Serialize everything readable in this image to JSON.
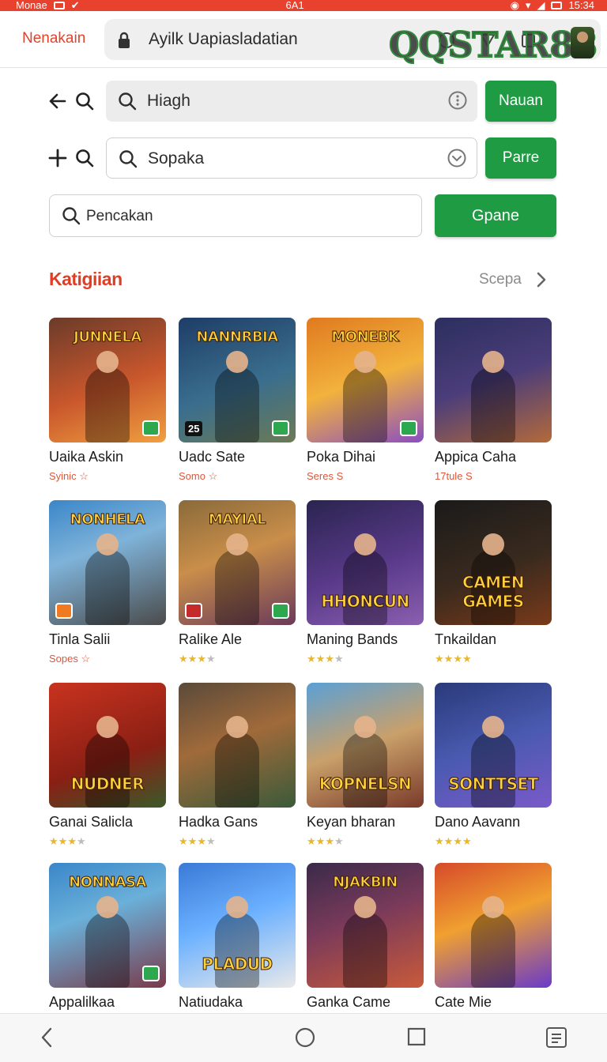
{
  "status_bar": {
    "carrier": "Monae",
    "clock_center": "6A1",
    "time": "15:34"
  },
  "browser": {
    "tab_label": "Nenakain",
    "url": "Ayilk Uapiasladatian",
    "brand_logo": "QQSTAR88"
  },
  "search_rows": [
    {
      "value": "Hiagh",
      "button": "Nauan",
      "style": "grey",
      "trailing_icon": "info-circle-icon",
      "lead_icons": [
        "back-arrow-icon",
        "search-icon"
      ]
    },
    {
      "value": "Sopaka",
      "button": "Parre",
      "style": "outline",
      "trailing_icon": "chevron-down-circle-icon",
      "lead_icons": [
        "plus-icon",
        "search-icon"
      ]
    },
    {
      "value": "Pencakan",
      "button": "Gpane",
      "style": "outline"
    }
  ],
  "section": {
    "title": "Katigiian",
    "link": "Scepa"
  },
  "games": [
    {
      "name": "Uaika Askin",
      "sub": "Syinic ☆",
      "thumb_text": "JUNNELA",
      "bg": "linear-gradient(160deg,#6b3b2a,#c9572c 55%,#f0a040)",
      "badge": "green"
    },
    {
      "name": "Uadc Sate",
      "sub": "Somo ☆",
      "thumb_text": "NANNRBIA",
      "bg": "linear-gradient(160deg,#1e3d66,#3a6e8e 55%,#6b7a55)",
      "badge": "green",
      "corner_num": "25"
    },
    {
      "name": "Poka Dihai",
      "sub": "Seres S",
      "thumb_text": "MONEBK",
      "bg": "linear-gradient(160deg,#e07a1f,#f2b23d 50%,#8a4ec2)",
      "badge": "green"
    },
    {
      "name": "Appica Caha",
      "sub": "17tule S",
      "thumb_text": "",
      "bg": "linear-gradient(160deg,#2c2f5e,#4b3d7a 50%,#b36a3a)",
      "badge": ""
    },
    {
      "name": "Tinla Salii",
      "sub": "Sopes ☆",
      "thumb_text": "NONHELA",
      "bg": "linear-gradient(160deg,#3a86c9,#7fb3d9 40%,#4b4b4b)",
      "badge": "orange-left"
    },
    {
      "name": "Ralike Ale",
      "rating": 3,
      "thumb_text": "MAYIAL",
      "bg": "linear-gradient(160deg,#8a6a3a,#c98e4a 45%,#6a3a5a)",
      "badge": "green-red"
    },
    {
      "name": "Maning Bands",
      "rating": 3,
      "thumb_text": "HHONCUN",
      "thumb_low": true,
      "bg": "linear-gradient(160deg,#2a2450,#5a3a8a 55%,#8b5fb0)",
      "badge": ""
    },
    {
      "name": "Tnkaildan",
      "rating": 4,
      "thumb_text": "CAMEN GAMES",
      "thumb_low": true,
      "bg": "linear-gradient(160deg,#1a1a1a,#3a2a1e 55%,#7a3a1a)",
      "badge": ""
    },
    {
      "name": "Ganai Salicla",
      "rating": 3,
      "thumb_text": "NUDNER",
      "thumb_low": true,
      "bg": "linear-gradient(160deg,#c9331f,#8a1f14 60%,#3a5a2a)",
      "badge": ""
    },
    {
      "name": "Hadka Gans",
      "rating": 3,
      "thumb_text": "",
      "bg": "linear-gradient(160deg,#5a4a3a,#a06a3a 45%,#3a5a3a)",
      "badge": ""
    },
    {
      "name": "Keyan bharan",
      "rating": 3,
      "thumb_text": "KOPNELSN",
      "thumb_low": true,
      "bg": "linear-gradient(160deg,#5aa0d6,#c9a06a 50%,#7a3a2a)",
      "badge": ""
    },
    {
      "name": "Dano Aavann",
      "rating": 4,
      "thumb_text": "SONTTSET",
      "thumb_low": true,
      "bg": "linear-gradient(160deg,#2a3a7a,#4a5ab0 50%,#7a5ac9)",
      "badge": ""
    },
    {
      "name": "Appalilkaa",
      "thumb_text": "NONNASA",
      "bg": "linear-gradient(160deg,#3a86c9,#6ab0d9 40%,#7a3a4a)",
      "badge": "green"
    },
    {
      "name": "Natiudaka",
      "thumb_text": "PLADUD",
      "thumb_low": true,
      "bg": "linear-gradient(160deg,#3a7ad6,#6ab0ff 45%,#e9e9e9)",
      "badge": ""
    },
    {
      "name": "Ganka Came",
      "thumb_text": "NJAKBIN",
      "bg": "linear-gradient(160deg,#3a2a4a,#7a3a5a 45%,#c95a3a)",
      "badge": ""
    },
    {
      "name": "Cate Mie",
      "thumb_text": "",
      "bg": "linear-gradient(160deg,#d64a2a,#f0a030 45%,#6a3ac9)",
      "badge": ""
    }
  ],
  "nav": [
    "back-icon",
    "home-icon",
    "recents-icon",
    "menu-icon"
  ]
}
